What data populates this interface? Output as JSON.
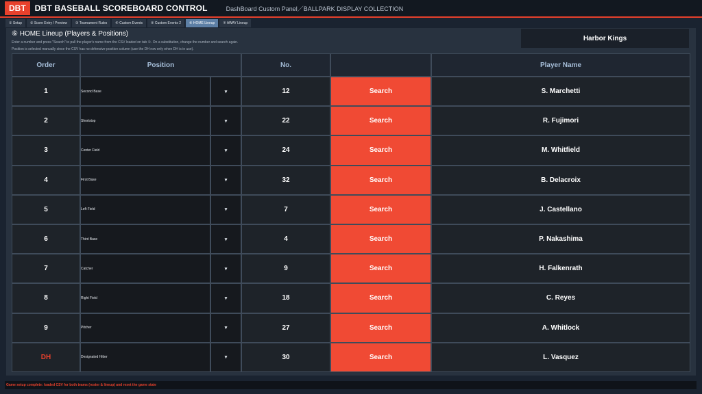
{
  "header": {
    "logo": "DBT",
    "title": "DBT BASEBALL SCOREBOARD CONTROL",
    "subtitle": "DashBoard Custom Panel／BALLPARK DISPLAY COLLECTION"
  },
  "tabs": [
    {
      "label": "① Setup"
    },
    {
      "label": "② Score Entry / Preview"
    },
    {
      "label": "③ Tournament Rules"
    },
    {
      "label": "④ Custom Events"
    },
    {
      "label": "⑤ Custom Events 2"
    },
    {
      "label": "⑥ HOME Lineup"
    },
    {
      "label": "⑦ AWAY Lineup"
    }
  ],
  "panel": {
    "title": "⑥ HOME Lineup (Players & Positions)",
    "desc1": "Enter a number and press \"Search\" to pull the player's name from the CSV loaded on tab ①.  On a substitution, change the number and search again.",
    "desc2": "Position is selected manually since the CSV has no defensive-position column (use the DH row only when DH is in use).",
    "team_name": "Harbor Kings"
  },
  "table": {
    "headers": {
      "order": "Order",
      "position": "Position",
      "no": "No.",
      "search": "",
      "player": "Player Name"
    },
    "caret": "▾",
    "search_label": "Search",
    "rows": [
      {
        "order": "1",
        "position": "Second Base",
        "no": "12",
        "player": "S. Marchetti"
      },
      {
        "order": "2",
        "position": "Shortstop",
        "no": "22",
        "player": "R. Fujimori"
      },
      {
        "order": "3",
        "position": "Center Field",
        "no": "24",
        "player": "M. Whitfield"
      },
      {
        "order": "4",
        "position": "First Base",
        "no": "32",
        "player": "B. Delacroix"
      },
      {
        "order": "5",
        "position": "Left Field",
        "no": "7",
        "player": "J. Castellano"
      },
      {
        "order": "6",
        "position": "Third Base",
        "no": "4",
        "player": "P. Nakashima"
      },
      {
        "order": "7",
        "position": "Catcher",
        "no": "9",
        "player": "H. Falkenrath"
      },
      {
        "order": "8",
        "position": "Right Field",
        "no": "18",
        "player": "C. Reyes"
      },
      {
        "order": "9",
        "position": "Pitcher",
        "no": "27",
        "player": "A. Whitlock"
      },
      {
        "order": "DH",
        "position": "Designated Hitter",
        "no": "30",
        "player": "L. Vasquez"
      }
    ]
  },
  "status": {
    "text": "Game setup complete: loaded CSV for both teams (roster & lineup) and reset the game state"
  },
  "colors": {
    "accent": "#e8412c",
    "active_tab": "#5d7fa5",
    "search_button": "#f04a34"
  }
}
